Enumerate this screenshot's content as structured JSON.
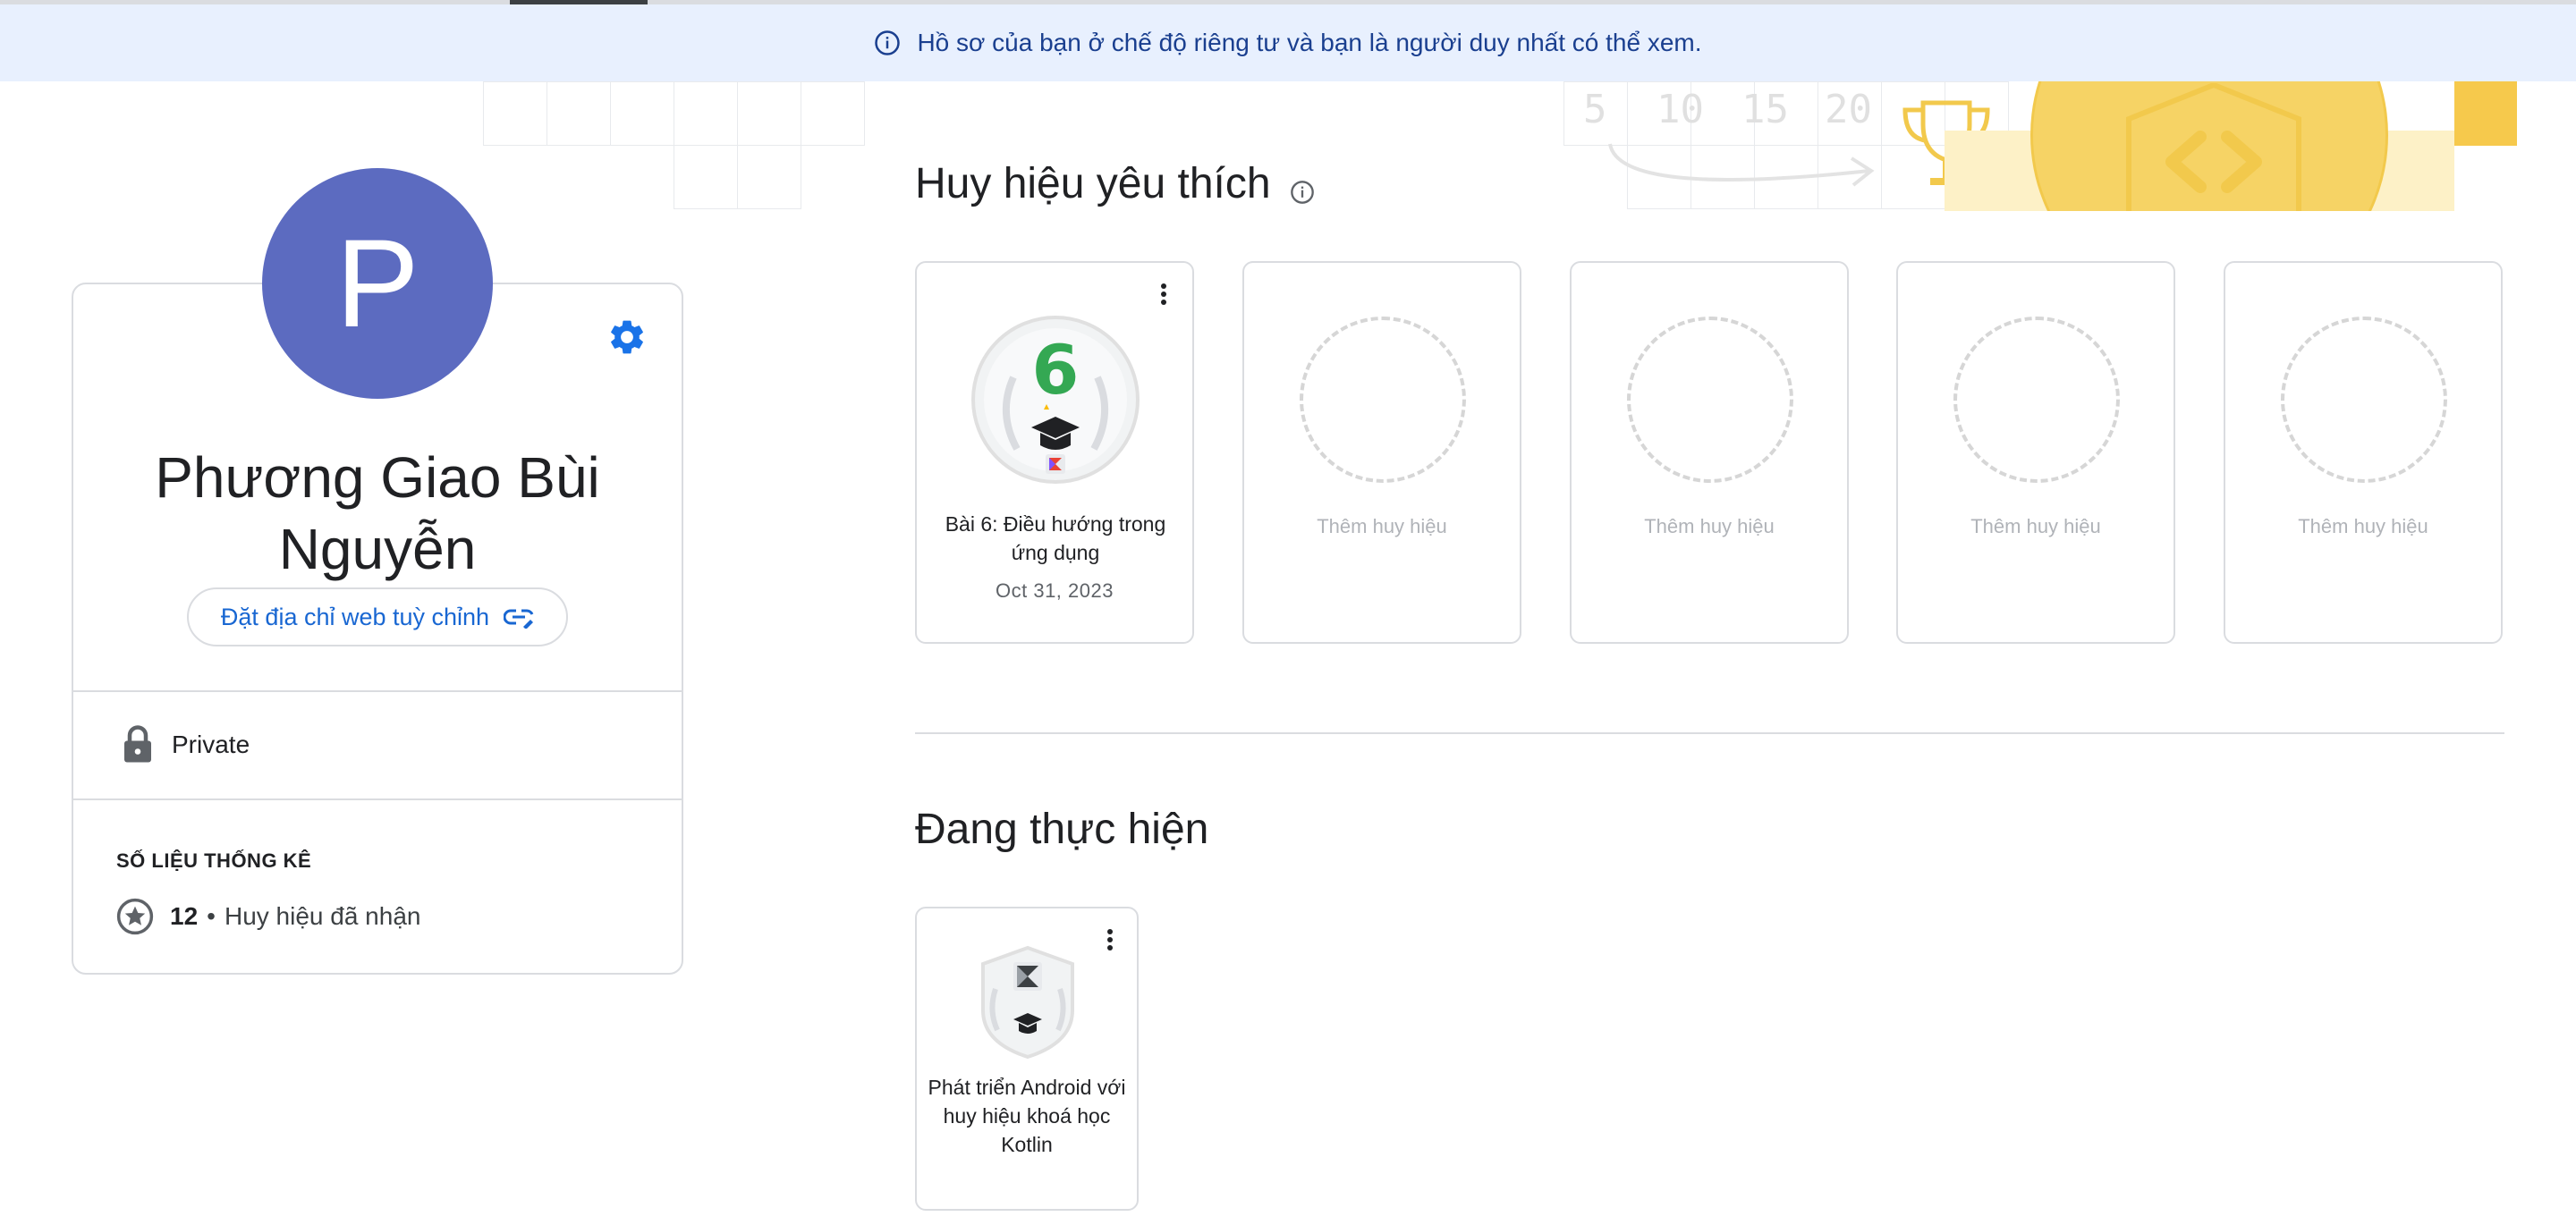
{
  "banner": {
    "icon": "info-icon",
    "text": "Hồ sơ của bạn ở chế độ riêng tư và bạn là người duy nhất có thể xem."
  },
  "header_art": {
    "numbers": [
      "5",
      "10",
      "15",
      "20"
    ],
    "icons": [
      "trophy-icon",
      "code-brackets-icon"
    ]
  },
  "profile": {
    "avatar_letter": "P",
    "avatar_color": "#5c6bc0",
    "name_line1": "Phương Giao Bùi",
    "name_line2": "Nguyễn",
    "custom_url_label": "Đặt địa chỉ web tuỳ chỉnh",
    "custom_url_icon": "link-edit-icon",
    "settings_icon": "gear-icon",
    "privacy_icon": "lock-icon",
    "privacy_label": "Private",
    "stats_title": "SỐ LIỆU THỐNG KÊ",
    "stats": {
      "icon": "star-circle-icon",
      "count": "12",
      "separator": "•",
      "label": "Huy hiệu đã nhận"
    }
  },
  "favorites": {
    "title": "Huy hiệu yêu thích",
    "info_icon": "info-icon",
    "badges": [
      {
        "title": "Bài 6: Điều hướng trong ứng dụng",
        "date": "Oct 31, 2023",
        "number": "6",
        "icon": "graduation-cap-badge-icon"
      }
    ],
    "empty_slots": [
      {
        "label": "Thêm huy hiệu"
      },
      {
        "label": "Thêm huy hiệu"
      },
      {
        "label": "Thêm huy hiệu"
      },
      {
        "label": "Thêm huy hiệu"
      }
    ]
  },
  "in_progress": {
    "title": "Đang thực hiện",
    "items": [
      {
        "title": "Phát triển Android với huy hiệu khoá học Kotlin",
        "icon": "kotlin-course-badge-icon"
      }
    ]
  },
  "colors": {
    "accent": "#1967d2",
    "banner_bg": "#e8f0fe",
    "badge_green": "#34a853",
    "art_yellow": "#f6d365"
  }
}
